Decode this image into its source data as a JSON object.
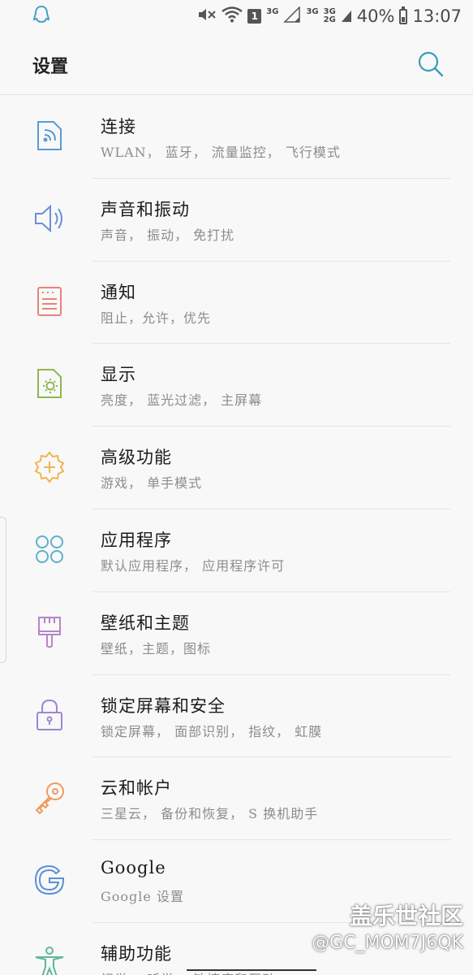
{
  "status_bar": {
    "network_3g_a": "3G",
    "network_3g_b": "3G",
    "network_3g2g_top": "3G",
    "network_3g2g_bottom": "2G",
    "badge": "1",
    "battery": "40%",
    "time": "13:07",
    "icons": [
      "notification-icon",
      "mute-icon",
      "wifi-icon",
      "signal-icon",
      "battery-icon"
    ]
  },
  "header": {
    "title": "设置",
    "search_icon": "search-icon"
  },
  "settings": [
    {
      "title": "连接",
      "subtitle": "WLAN， 蓝牙， 流量监控， 飞行模式",
      "icon": "connections-icon",
      "color": "#5b9bd5"
    },
    {
      "title": "声音和振动",
      "subtitle": "声音， 振动， 免打扰",
      "icon": "sound-icon",
      "color": "#6b8fd6"
    },
    {
      "title": "通知",
      "subtitle": "阻止，允许，优先",
      "icon": "notification-icon",
      "color": "#e8837a"
    },
    {
      "title": "显示",
      "subtitle": "亮度， 蓝光过滤， 主屏幕",
      "icon": "display-icon",
      "color": "#8fb84d"
    },
    {
      "title": "高级功能",
      "subtitle": "游戏， 单手模式",
      "icon": "advanced-features-icon",
      "color": "#f0b44e"
    },
    {
      "title": "应用程序",
      "subtitle": "默认应用程序， 应用程序许可",
      "icon": "apps-icon",
      "color": "#5db1cc"
    },
    {
      "title": "壁纸和主题",
      "subtitle": "壁纸，主题，图标",
      "icon": "wallpaper-brush-icon",
      "color": "#b784c9"
    },
    {
      "title": "锁定屏幕和安全",
      "subtitle": "锁定屏幕， 面部识别， 指纹， 虹膜",
      "icon": "lock-icon",
      "color": "#9b86d6"
    },
    {
      "title": "云和帐户",
      "subtitle": "三星云， 备份和恢复， S 换机助手",
      "icon": "key-icon",
      "color": "#ef9a5e"
    },
    {
      "title": "Google",
      "subtitle": "Google 设置",
      "icon": "google-icon",
      "color": "#5b8fd6"
    },
    {
      "title": "辅助功能",
      "subtitle": "视觉， 听觉， 敏捷度和互动",
      "icon": "accessibility-icon",
      "color": "#5fb89a"
    }
  ],
  "watermark": {
    "line1": "盖乐世社区",
    "line2": "@GC_MOM7J6QK"
  }
}
